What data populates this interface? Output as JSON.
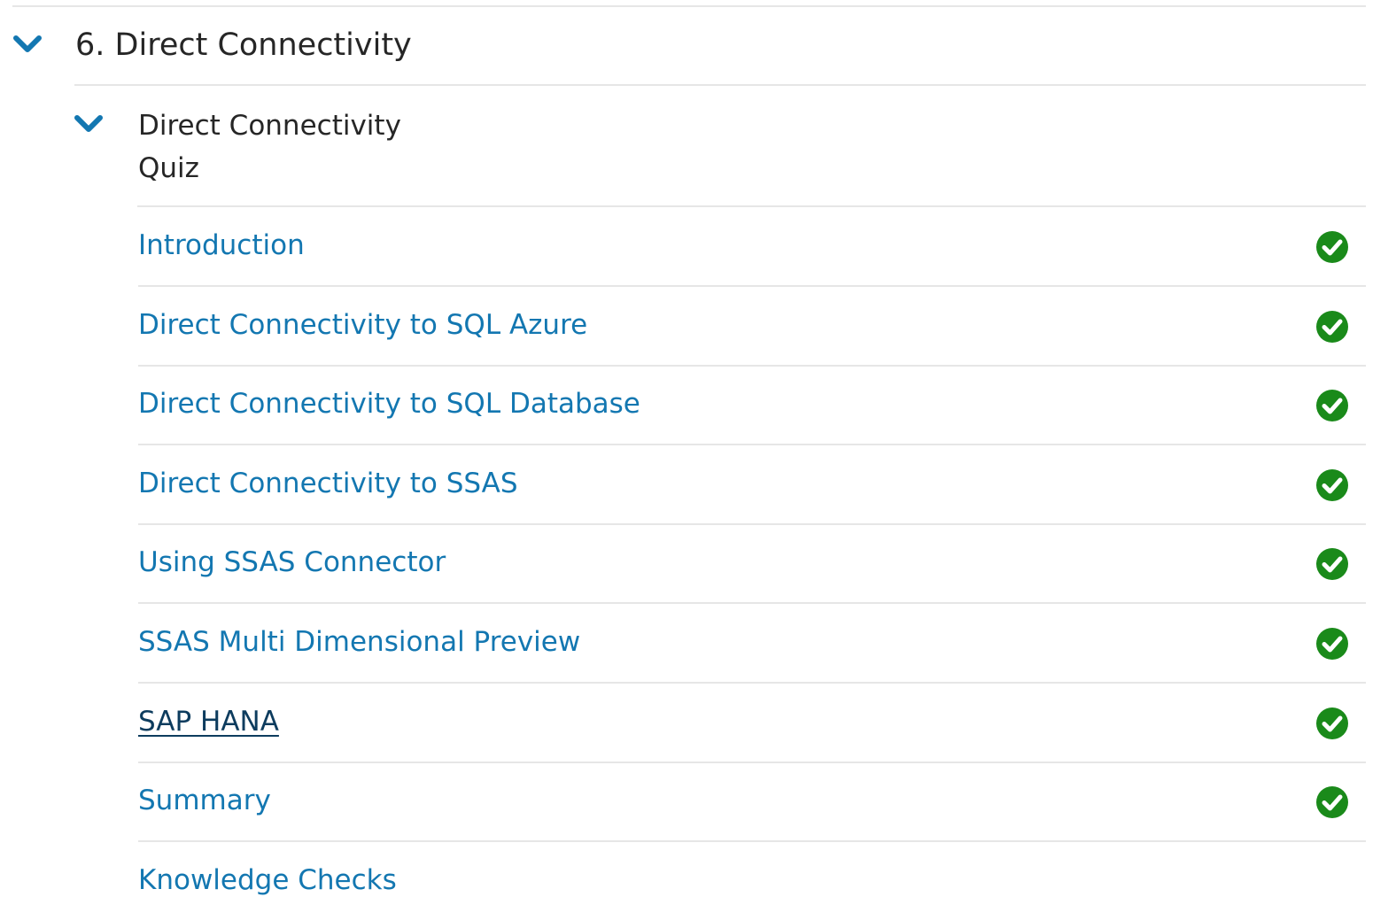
{
  "colors": {
    "accent": "#1377b1",
    "visited_link": "#0d3c5e",
    "complete": "#1a8a1a",
    "divider": "#e6e6e6",
    "text": "#262626"
  },
  "section": {
    "title": "6. Direct Connectivity",
    "expanded": true,
    "icon": "chevron-down-icon"
  },
  "subsection": {
    "title_line1": "Direct Connectivity",
    "title_line2": "Quiz",
    "expanded": true,
    "icon": "chevron-down-icon"
  },
  "items": [
    {
      "label": "Introduction",
      "completed": true,
      "icon": "check-circle-icon"
    },
    {
      "label": "Direct Connectivity to SQL Azure",
      "completed": true,
      "icon": "check-circle-icon"
    },
    {
      "label": "Direct Connectivity to SQL Database",
      "completed": true,
      "icon": "check-circle-icon"
    },
    {
      "label": "Direct Connectivity to SSAS",
      "completed": true,
      "icon": "check-circle-icon"
    },
    {
      "label": "Using SSAS Connector",
      "completed": true,
      "icon": "check-circle-icon"
    },
    {
      "label": "SSAS Multi Dimensional Preview",
      "completed": true,
      "icon": "check-circle-icon"
    },
    {
      "label": "SAP HANA",
      "completed": true,
      "visited": true,
      "icon": "check-circle-icon"
    },
    {
      "label": "Summary",
      "completed": true,
      "icon": "check-circle-icon"
    },
    {
      "label": "Knowledge Checks",
      "completed": false
    }
  ]
}
